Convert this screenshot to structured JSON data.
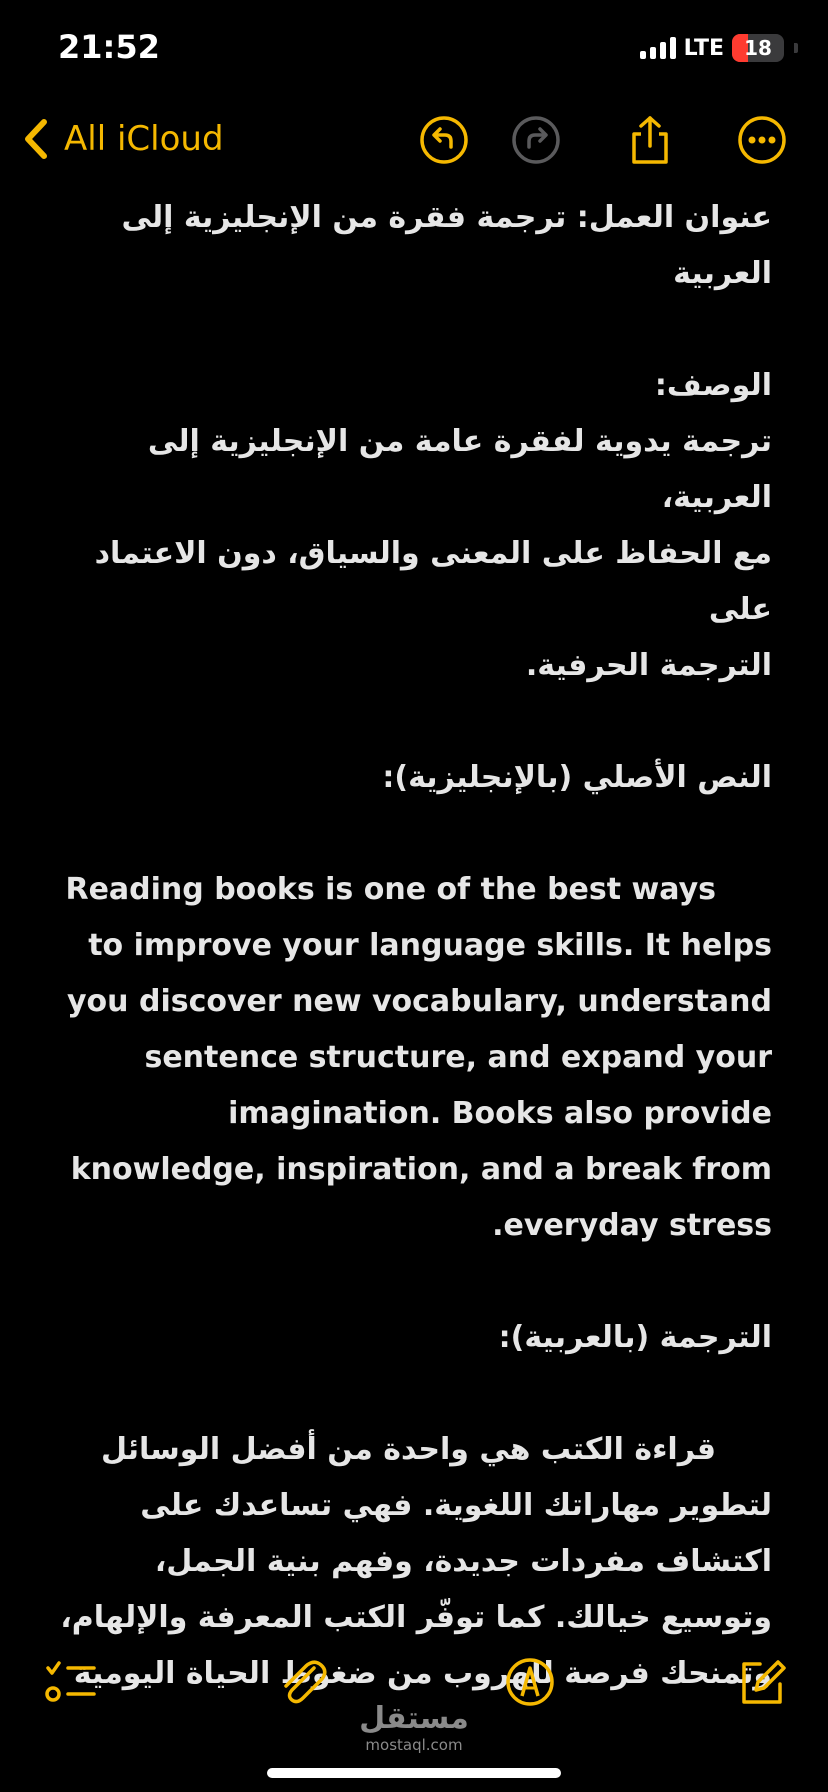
{
  "status_bar": {
    "time": "21:52",
    "network": "LTE",
    "battery": "18",
    "icons": [
      "signal-bars-icon",
      "battery-icon"
    ]
  },
  "nav": {
    "back_label": "All iCloud",
    "icons": [
      "chevron-left-icon",
      "undo-icon",
      "redo-icon",
      "share-icon",
      "more-icon"
    ],
    "accent_color": "#f5b800"
  },
  "note": {
    "lines": [
      "عنوان العمل: ترجمة فقرة من الإنجليزية إلى",
      "العربية",
      "الوصف:",
      "ترجمة يدوية لفقرة عامة من الإنجليزية إلى العربية،",
      "مع الحفاظ على المعنى والسياق، دون الاعتماد على",
      "الترجمة الحرفية.",
      "النص الأصلي (بالإنجليزية):",
      "Reading books is one of the best ways",
      "to improve your language skills. It helps",
      "you discover new vocabulary, understand",
      "sentence structure, and expand your",
      "imagination. Books also provide",
      "knowledge, inspiration, and a break from",
      ".everyday stress",
      "الترجمة (بالعربية):",
      "قراءة الكتب هي واحدة من أفضل الوسائل",
      "لتطوير مهاراتك اللغوية. فهي تساعدك على",
      "اكتشاف مفردات جديدة، وفهم بنية الجمل،",
      "وتوسيع خيالك. كما توفّر الكتب المعرفة والإلهام،",
      "وتمنحك فرصة للهروب من ضغوط الحياة اليومية"
    ]
  },
  "toolbar": {
    "icons": [
      "checklist-icon",
      "paperclip-icon",
      "markup-pen-icon",
      "compose-icon"
    ]
  },
  "watermark": {
    "arabic": "مستقل",
    "latin": "mostaql.com"
  }
}
